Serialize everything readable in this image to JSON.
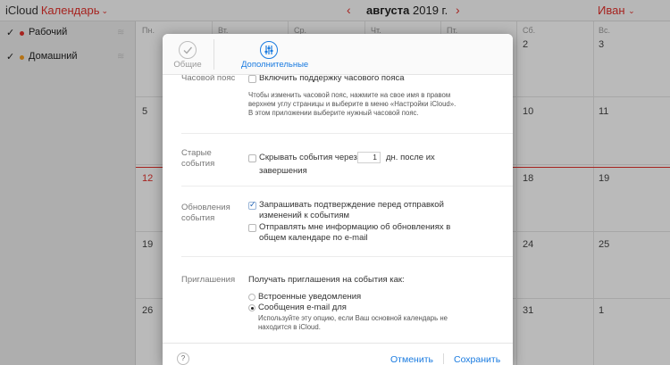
{
  "header": {
    "brand_icloud": "iCloud",
    "brand_app": "Календарь",
    "month": "августа",
    "year": "2019 г.",
    "user": "Иван"
  },
  "sidebar": {
    "calendars": [
      {
        "name": "Рабочий",
        "color": "#e0302b"
      },
      {
        "name": "Домашний",
        "color": "#f39a1e"
      }
    ]
  },
  "grid": {
    "day_headers": [
      "Пн.",
      "Вт.",
      "Ср.",
      "Чт.",
      "Пт.",
      "Сб.",
      "Вс."
    ],
    "days": [
      "2",
      "3",
      "4",
      "5",
      "9",
      "10",
      "11",
      "12",
      "16",
      "17",
      "18",
      "19",
      "23",
      "24",
      "25",
      "26",
      "30",
      "31",
      "1"
    ]
  },
  "modal": {
    "tabs": {
      "general": "Общие",
      "advanced": "Дополнительные"
    },
    "timezone": {
      "label": "Часовой пояс",
      "checkbox_label": "Включить поддержку часового пояса",
      "note_line1": "Чтобы изменить часовой пояс, нажмите на свое имя в правом",
      "note_line2": "верхнем углу страницы и выберите в меню «Настройки iCloud».",
      "note_line3": "В этом приложении выберите нужный часовой пояс."
    },
    "old_events": {
      "label_line1": "Старые",
      "label_line2": "события",
      "checkbox_label": "Скрывать события через",
      "days_value": "1",
      "suffix": "дн. после их",
      "suffix_line2": "завершения"
    },
    "updates": {
      "label_line1": "Обновления",
      "label_line2": "события",
      "option1_line1": "Запрашивать подтверждение перед отправкой",
      "option1_line2": "изменений к событиям",
      "option1_checked": true,
      "option2_line1": "Отправлять мне информацию об обновлениях в",
      "option2_line2": "общем календаре по e-mail",
      "option2_checked": false
    },
    "invitations": {
      "label": "Приглашения",
      "heading": "Получать приглашения на события как:",
      "option1": "Встроенные уведомления",
      "option2": "Сообщения e-mail для",
      "selected": "option2",
      "note_line1": "Используйте эту опцию, если Ваш основной календарь не",
      "note_line2": "находится в iCloud."
    },
    "footer": {
      "help": "?",
      "cancel": "Отменить",
      "save": "Сохранить"
    }
  }
}
